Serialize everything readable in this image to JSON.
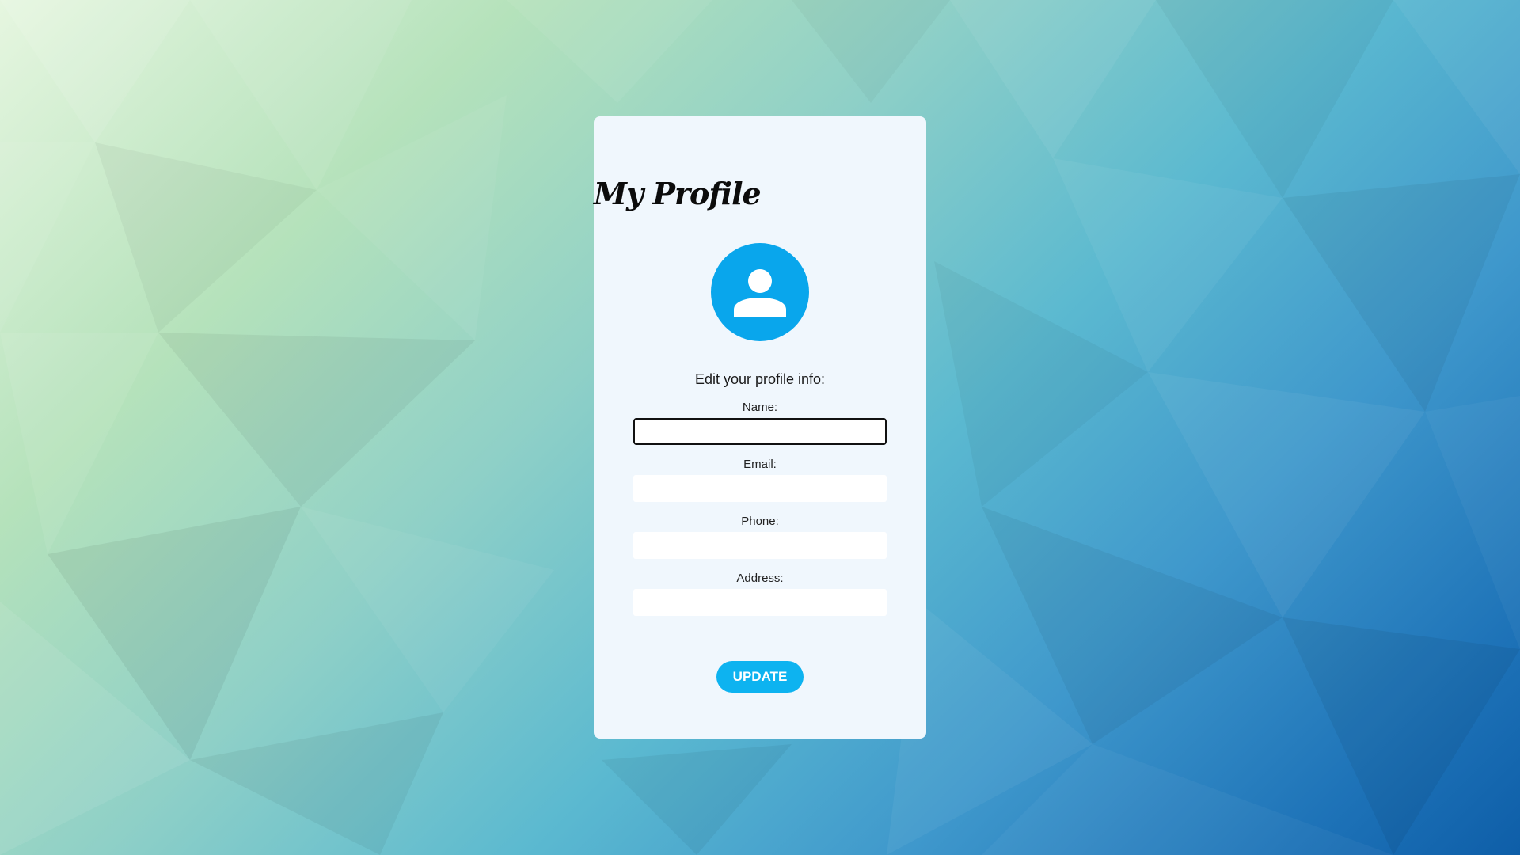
{
  "profile": {
    "title": "My Profile",
    "avatar_icon": "user-icon",
    "subtitle": "Edit your profile info:",
    "fields": [
      {
        "label": "Name:",
        "value": ""
      },
      {
        "label": "Email:",
        "value": ""
      },
      {
        "label": "Phone:",
        "value": ""
      },
      {
        "label": "Address:",
        "value": ""
      }
    ],
    "update_label": "UPDATE"
  },
  "colors": {
    "accent": "#09a6ec",
    "button": "#0db3f0",
    "card_background": "#f0f7fd"
  }
}
